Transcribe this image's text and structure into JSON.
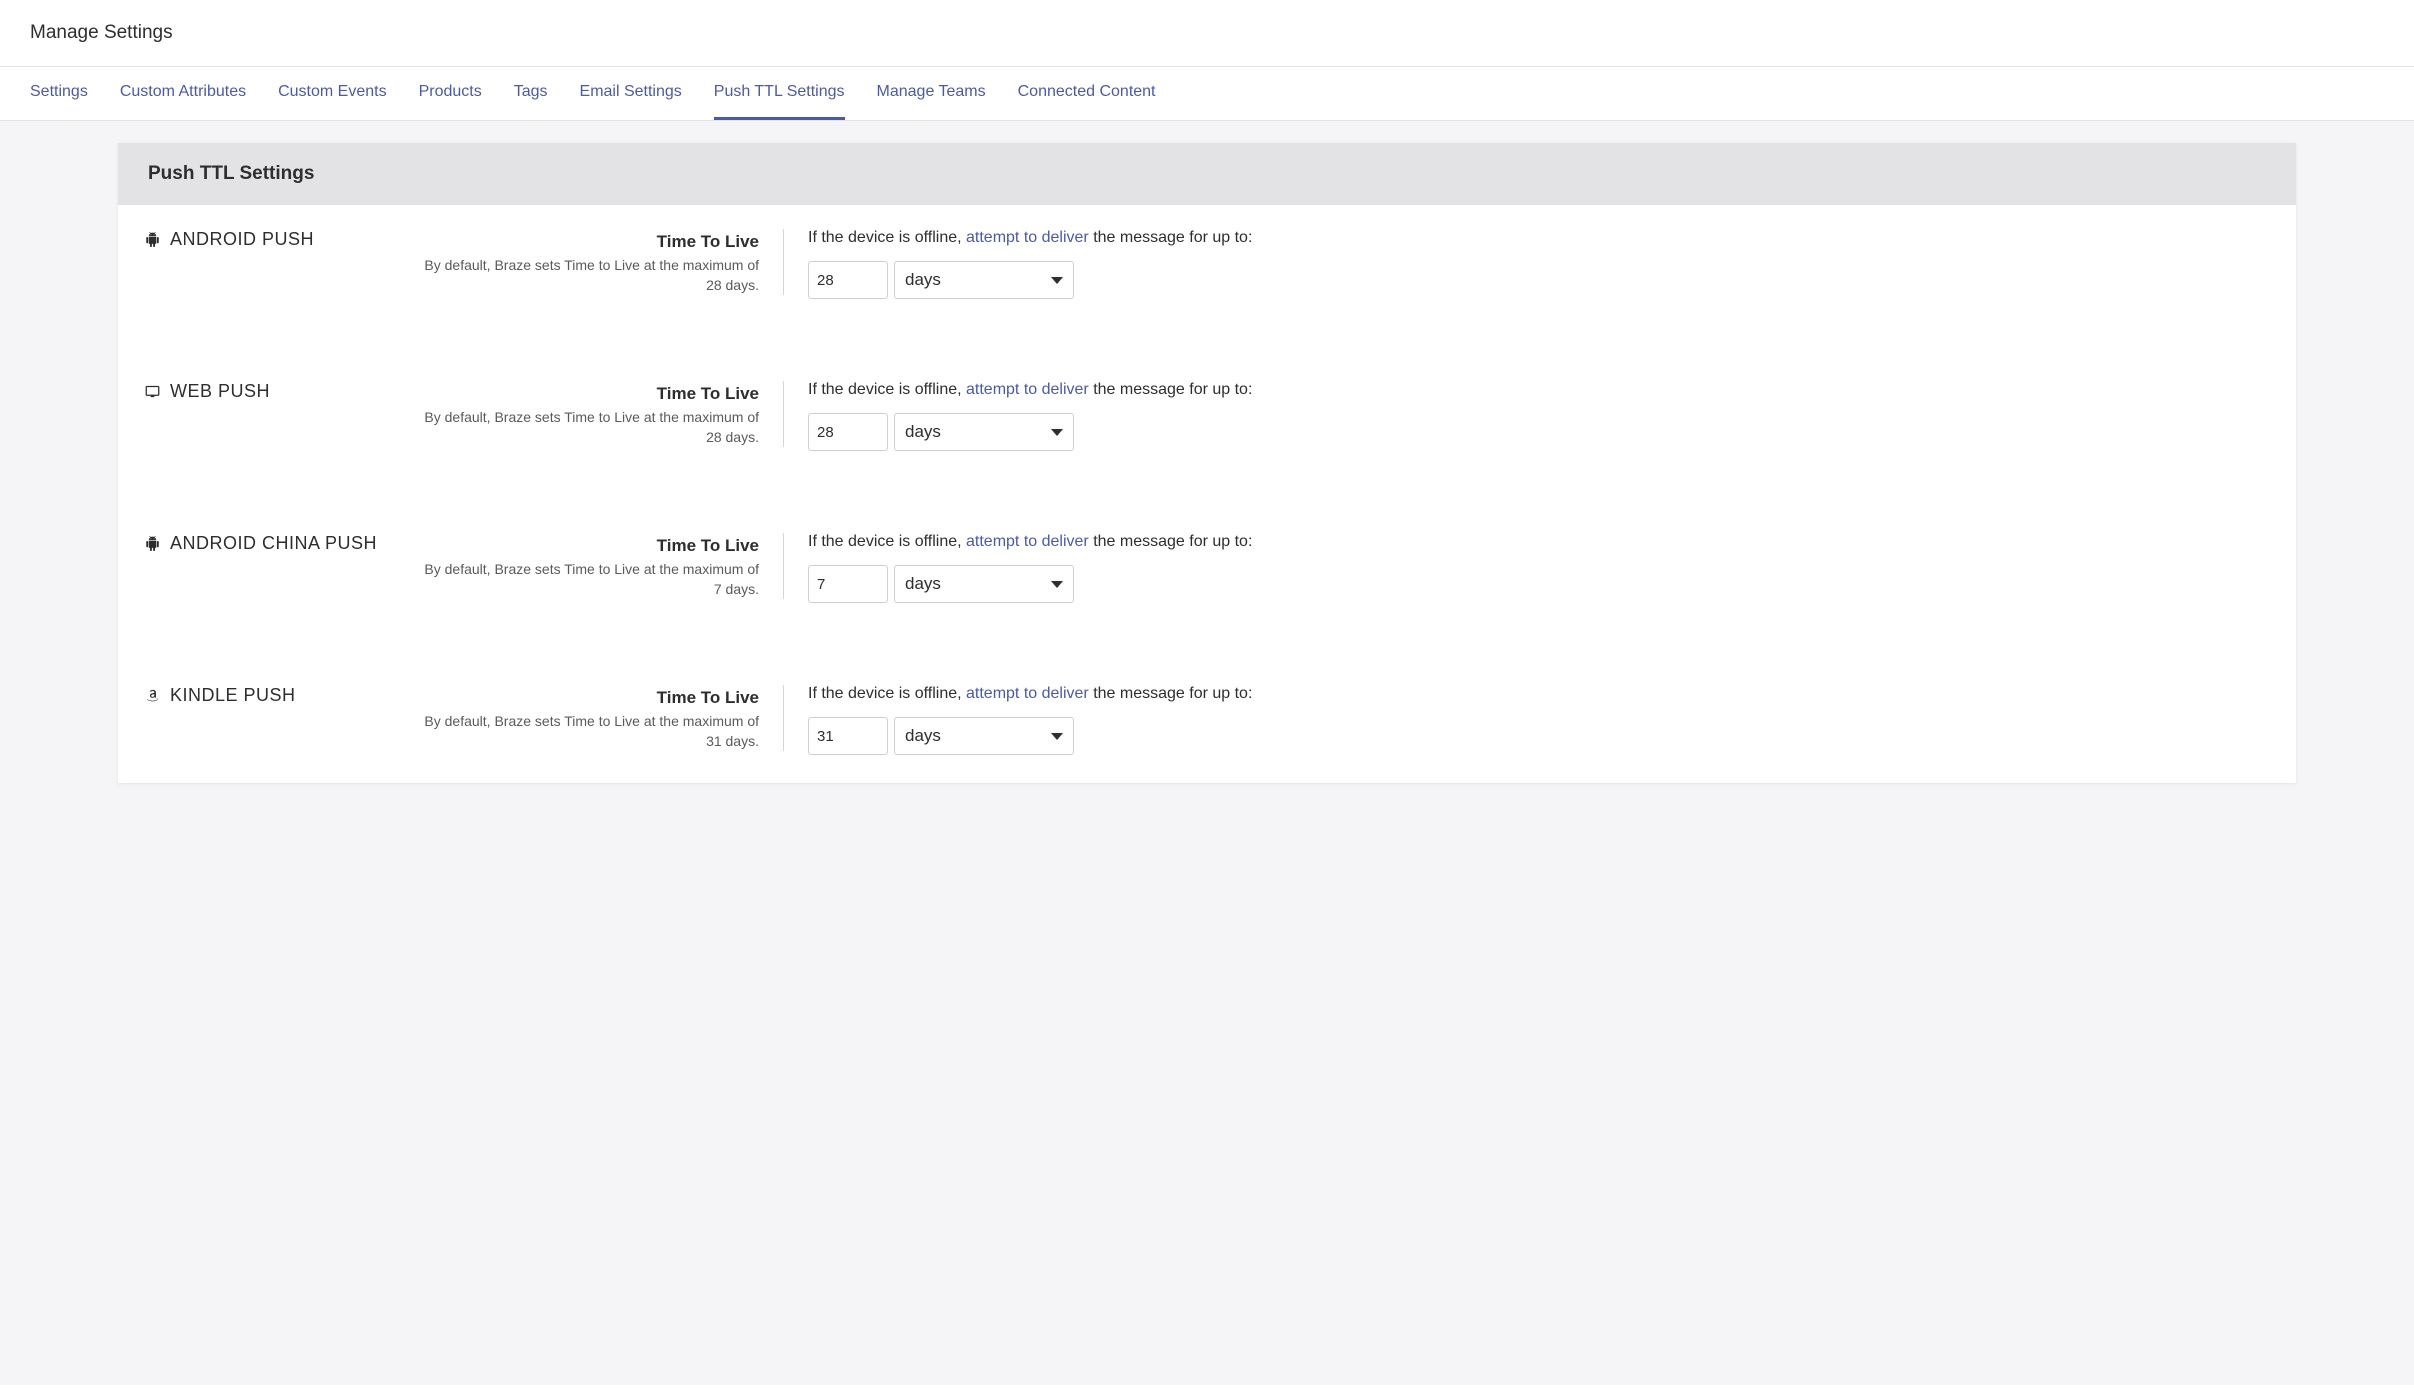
{
  "header": {
    "title": "Manage Settings"
  },
  "tabs": [
    {
      "label": "Settings",
      "active": false
    },
    {
      "label": "Custom Attributes",
      "active": false
    },
    {
      "label": "Custom Events",
      "active": false
    },
    {
      "label": "Products",
      "active": false
    },
    {
      "label": "Tags",
      "active": false
    },
    {
      "label": "Email Settings",
      "active": false
    },
    {
      "label": "Push TTL Settings",
      "active": true
    },
    {
      "label": "Manage Teams",
      "active": false
    },
    {
      "label": "Connected Content",
      "active": false
    }
  ],
  "panel": {
    "title": "Push TTL Settings"
  },
  "common": {
    "ttl_label": "Time To Live",
    "sentence_prefix": "If the device is offline, ",
    "sentence_link": "attempt to deliver",
    "sentence_suffix": " the message for up to:"
  },
  "rows": [
    {
      "icon": "android-icon",
      "platform": "ANDROID PUSH",
      "desc": "By default, Braze sets Time to Live at the maximum of 28 days.",
      "value": "28",
      "unit": "days"
    },
    {
      "icon": "monitor-icon",
      "platform": "WEB PUSH",
      "desc": "By default, Braze sets Time to Live at the maximum of 28 days.",
      "value": "28",
      "unit": "days"
    },
    {
      "icon": "android-icon",
      "platform": "ANDROID CHINA PUSH",
      "desc": "By default, Braze sets Time to Live at the maximum of 7 days.",
      "value": "7",
      "unit": "days"
    },
    {
      "icon": "amazon-icon",
      "platform": "KINDLE PUSH",
      "desc": "By default, Braze sets Time to Live at the maximum of 31 days.",
      "value": "31",
      "unit": "days"
    }
  ]
}
